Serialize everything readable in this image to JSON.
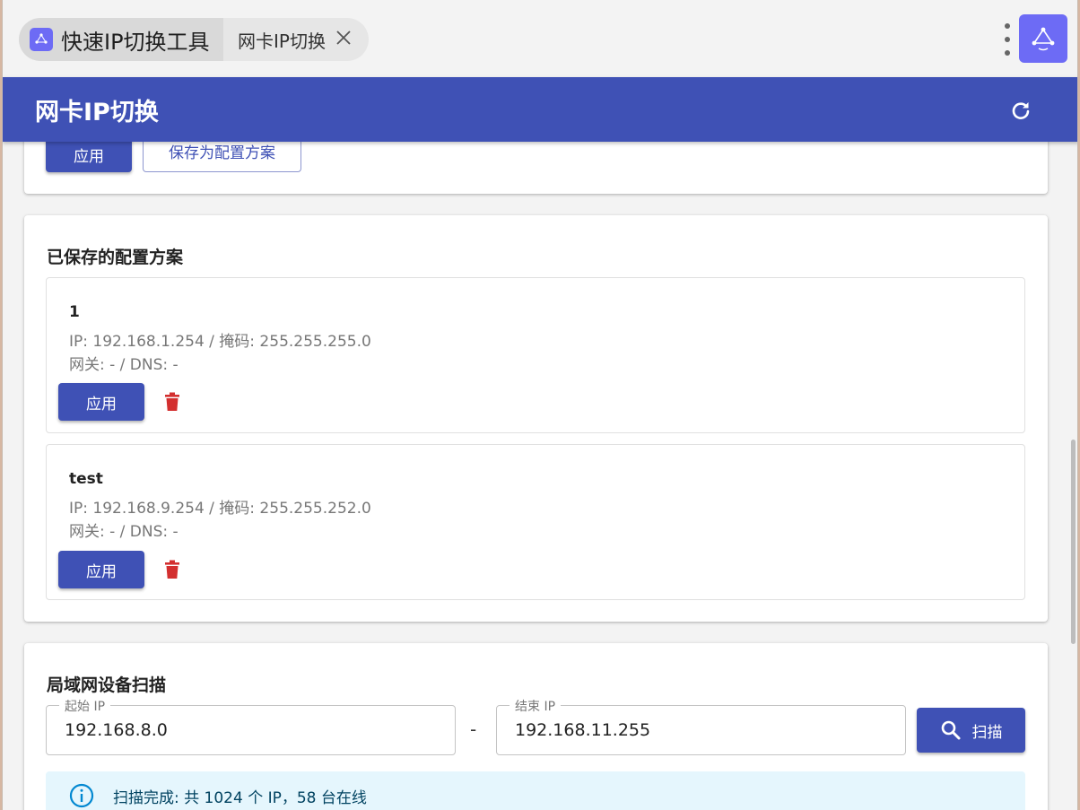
{
  "window": {
    "app_tab_label": "快速IP切换工具",
    "page_tab_label": "网卡IP切换",
    "close_glyph": "✕"
  },
  "appbar": {
    "title": "网卡IP切换"
  },
  "config_card": {
    "apply_label": "应用",
    "save_label": "保存为配置方案"
  },
  "saved_profiles": {
    "title": "已保存的配置方案",
    "items": [
      {
        "name": "1",
        "ip_line": "IP: 192.168.1.254 / 掩码: 255.255.255.0",
        "gw_line": "网关: - / DNS: -",
        "apply_label": "应用"
      },
      {
        "name": "test",
        "ip_line": "IP: 192.168.9.254 / 掩码: 255.255.252.0",
        "gw_line": "网关: - / DNS: -",
        "apply_label": "应用"
      }
    ]
  },
  "scan": {
    "title": "局域网设备扫描",
    "start_label": "起始 IP",
    "start_value": "192.168.8.0",
    "separator": "-",
    "end_label": "结束 IP",
    "end_value": "192.168.11.255",
    "scan_label": "扫描",
    "result": "扫描完成: 共 1024 个 IP，58 台在线"
  },
  "colors": {
    "primary": "#3f51b5",
    "app_icon": "#6d6bf5",
    "danger": "#d32f2f",
    "info_bg": "#e5f6fd",
    "info_icon": "#0288d1"
  },
  "icons": {
    "app": "network-triangle-icon",
    "refresh": "refresh-icon",
    "delete": "trash-icon",
    "scan": "search-icon",
    "info": "info-icon"
  }
}
